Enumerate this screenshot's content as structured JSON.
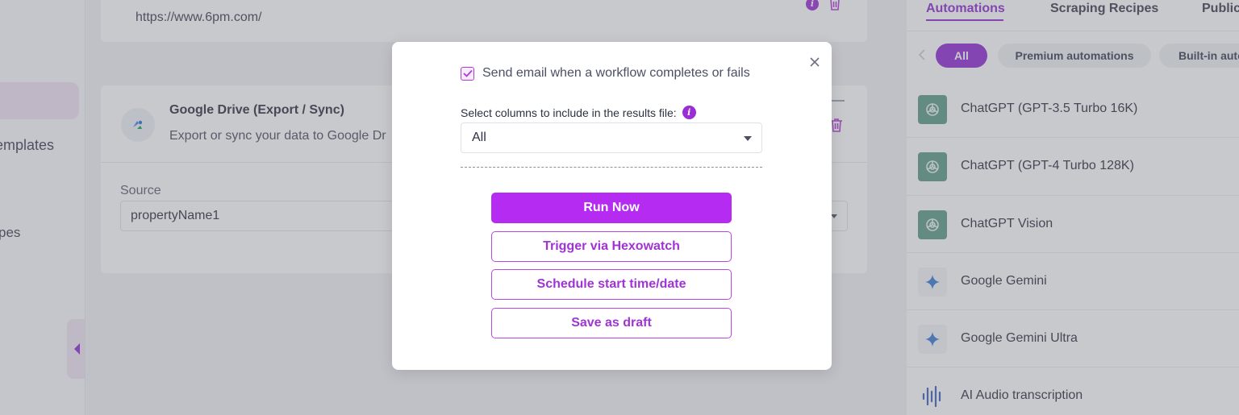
{
  "sidebar": {
    "templates_label": "emplates",
    "recipes_label": "pes"
  },
  "main": {
    "url_card": {
      "url": "https://www.6pm.com/"
    },
    "google_drive_card": {
      "title": "Google Drive (Export / Sync)",
      "description": "Export or sync your data to Google Dr",
      "source_label": "Source",
      "source_value": "propertyName1"
    }
  },
  "right_panel": {
    "tabs": [
      {
        "label": "Automations",
        "active": true
      },
      {
        "label": "Scraping Recipes",
        "active": false
      },
      {
        "label": "Public S",
        "active": false
      }
    ],
    "chips": [
      {
        "label": "All",
        "active": true
      },
      {
        "label": "Premium automations",
        "active": false
      },
      {
        "label": "Built-in auto",
        "active": false
      }
    ],
    "items": [
      {
        "label": "ChatGPT (GPT-3.5 Turbo 16K)",
        "icon": "chatgpt-icon"
      },
      {
        "label": "ChatGPT (GPT-4 Turbo 128K)",
        "icon": "chatgpt-icon"
      },
      {
        "label": "ChatGPT Vision",
        "icon": "chatgpt-icon"
      },
      {
        "label": "Google Gemini",
        "icon": "gemini-icon"
      },
      {
        "label": "Google Gemini Ultra",
        "icon": "gemini-icon"
      },
      {
        "label": "AI Audio transcription",
        "icon": "audio-wave-icon"
      }
    ]
  },
  "modal": {
    "email_checkbox_label": "Send email when a workflow completes or fails",
    "email_checked": true,
    "columns_label": "Select columns to include in the results file:",
    "columns_value": "All",
    "buttons": {
      "run_now": "Run Now",
      "trigger": "Trigger via Hexowatch",
      "schedule": "Schedule start time/date",
      "draft": "Save as draft"
    }
  },
  "colors": {
    "accent": "#8f2ad6",
    "primary_button": "#b52bf2",
    "chatgpt_icon_bg": "#5e9c86"
  }
}
